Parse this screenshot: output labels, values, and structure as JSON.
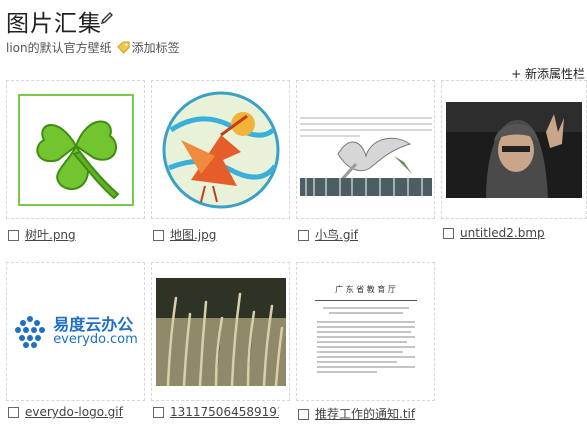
{
  "header": {
    "title": "图片汇集",
    "subtitle_text": "lion的默认官方壁纸",
    "add_tag_label": "添加标签",
    "add_property_label": "+ 新添属性栏"
  },
  "files": [
    {
      "name": "树叶.png"
    },
    {
      "name": "地图.jpg"
    },
    {
      "name": "小鸟.gif"
    },
    {
      "name": "untitled2.bmp"
    },
    {
      "name": "everydo-logo.gif"
    },
    {
      "name": "131175064589191h"
    },
    {
      "name": "推荐工作的通知.tif"
    }
  ],
  "logo": {
    "line1": "易度云办公",
    "line2": "everydo.com"
  },
  "document_thumb": {
    "heading": "广 东 省 教 育 厅"
  },
  "colors": {
    "clover_green": "#6fc22b",
    "logo_blue": "#1e6fc6"
  }
}
